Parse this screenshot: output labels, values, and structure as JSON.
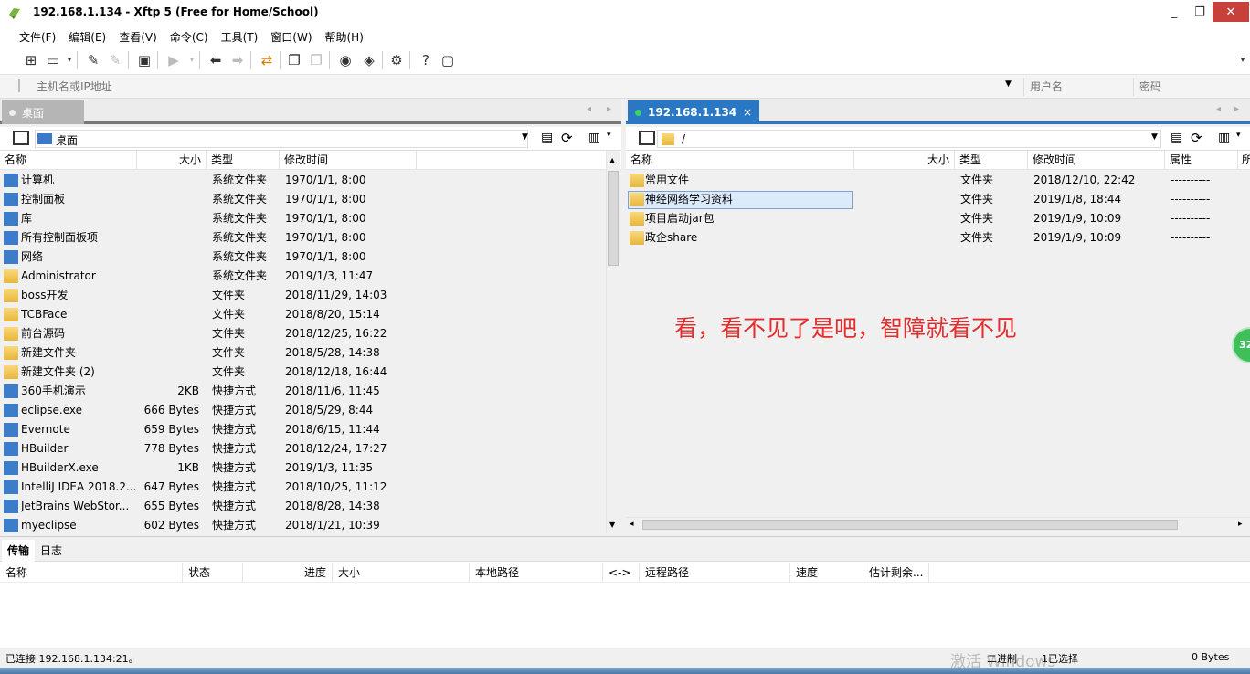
{
  "window": {
    "title": "192.168.1.134    - Xftp 5 (Free for Home/School)",
    "min": "_",
    "max": "❐",
    "close": "✕"
  },
  "menu": [
    "文件(F)",
    "编辑(E)",
    "查看(V)",
    "命令(C)",
    "工具(T)",
    "窗口(W)",
    "帮助(H)"
  ],
  "address": {
    "host_placeholder": "主机名或IP地址",
    "user_placeholder": "用户名",
    "pass_placeholder": "密码"
  },
  "left": {
    "tab": "桌面",
    "path": "桌面",
    "columns": [
      "名称",
      "大小",
      "类型",
      "修改时间"
    ],
    "rows": [
      {
        "name": "计算机",
        "size": "",
        "type": "系统文件夹",
        "mtime": "1970/1/1, 8:00",
        "icon": "computer-icon"
      },
      {
        "name": "控制面板",
        "size": "",
        "type": "系统文件夹",
        "mtime": "1970/1/1, 8:00",
        "icon": "control-panel-icon"
      },
      {
        "name": "库",
        "size": "",
        "type": "系统文件夹",
        "mtime": "1970/1/1, 8:00",
        "icon": "library-icon"
      },
      {
        "name": "所有控制面板项",
        "size": "",
        "type": "系统文件夹",
        "mtime": "1970/1/1, 8:00",
        "icon": "control-panel-icon"
      },
      {
        "name": "网络",
        "size": "",
        "type": "系统文件夹",
        "mtime": "1970/1/1, 8:00",
        "icon": "network-icon"
      },
      {
        "name": "Administrator",
        "size": "",
        "type": "系统文件夹",
        "mtime": "2019/1/3, 11:47",
        "icon": "folder-icon"
      },
      {
        "name": "boss开发",
        "size": "",
        "type": "文件夹",
        "mtime": "2018/11/29, 14:03",
        "icon": "folder-icon"
      },
      {
        "name": "TCBFace",
        "size": "",
        "type": "文件夹",
        "mtime": "2018/8/20, 15:14",
        "icon": "folder-icon"
      },
      {
        "name": "前台源码",
        "size": "",
        "type": "文件夹",
        "mtime": "2018/12/25, 16:22",
        "icon": "folder-icon"
      },
      {
        "name": "新建文件夹",
        "size": "",
        "type": "文件夹",
        "mtime": "2018/5/28, 14:38",
        "icon": "folder-icon"
      },
      {
        "name": "新建文件夹 (2)",
        "size": "",
        "type": "文件夹",
        "mtime": "2018/12/18, 16:44",
        "icon": "folder-icon"
      },
      {
        "name": "360手机演示",
        "size": "2KB",
        "type": "快捷方式",
        "mtime": "2018/11/6, 11:45",
        "icon": "shortcut-icon"
      },
      {
        "name": "eclipse.exe",
        "size": "666 Bytes",
        "type": "快捷方式",
        "mtime": "2018/5/29, 8:44",
        "icon": "shortcut-icon"
      },
      {
        "name": "Evernote",
        "size": "659 Bytes",
        "type": "快捷方式",
        "mtime": "2018/6/15, 11:44",
        "icon": "shortcut-icon"
      },
      {
        "name": "HBuilder",
        "size": "778 Bytes",
        "type": "快捷方式",
        "mtime": "2018/12/24, 17:27",
        "icon": "shortcut-icon"
      },
      {
        "name": "HBuilderX.exe",
        "size": "1KB",
        "type": "快捷方式",
        "mtime": "2019/1/3, 11:35",
        "icon": "shortcut-icon"
      },
      {
        "name": "IntelliJ IDEA 2018.2...",
        "size": "647 Bytes",
        "type": "快捷方式",
        "mtime": "2018/10/25, 11:12",
        "icon": "shortcut-icon"
      },
      {
        "name": "JetBrains WebStor...",
        "size": "655 Bytes",
        "type": "快捷方式",
        "mtime": "2018/8/28, 14:38",
        "icon": "shortcut-icon"
      },
      {
        "name": "myeclipse",
        "size": "602 Bytes",
        "type": "快捷方式",
        "mtime": "2018/1/21, 10:39",
        "icon": "shortcut-icon"
      }
    ]
  },
  "right": {
    "tab": "192.168.1.134",
    "tab_close": "×",
    "path": "/",
    "columns": [
      "名称",
      "大小",
      "类型",
      "修改时间",
      "属性",
      "所"
    ],
    "rows": [
      {
        "name": "常用文件",
        "size": "",
        "type": "文件夹",
        "mtime": "2018/12/10, 22:42",
        "attr": "----------"
      },
      {
        "name": "神经网络学习资料",
        "size": "",
        "type": "文件夹",
        "mtime": "2019/1/8, 18:44",
        "attr": "----------"
      },
      {
        "name": "项目启动jar包",
        "size": "",
        "type": "文件夹",
        "mtime": "2019/1/9, 10:09",
        "attr": "----------"
      },
      {
        "name": "政企share",
        "size": "",
        "type": "文件夹",
        "mtime": "2019/1/9, 10:09",
        "attr": "----------"
      }
    ],
    "selected_index": 1,
    "annotation": "看，看不见了是吧，智障就看不见"
  },
  "transfer": {
    "tabs": [
      "传输",
      "日志"
    ],
    "columns": [
      "名称",
      "状态",
      "进度",
      "大小",
      "本地路径",
      "<->",
      "远程路径",
      "速度",
      "估计剩余..."
    ]
  },
  "status": {
    "connection": "已连接 192.168.1.134:21。",
    "mode": "二进制",
    "selection": "1已选择",
    "bytes": "0 Bytes",
    "watermark": "激活 Windows"
  },
  "badge": "32",
  "colors": {
    "accent": "#2a78c4",
    "annotation": "#e52d2d",
    "close": "#c7403a"
  }
}
